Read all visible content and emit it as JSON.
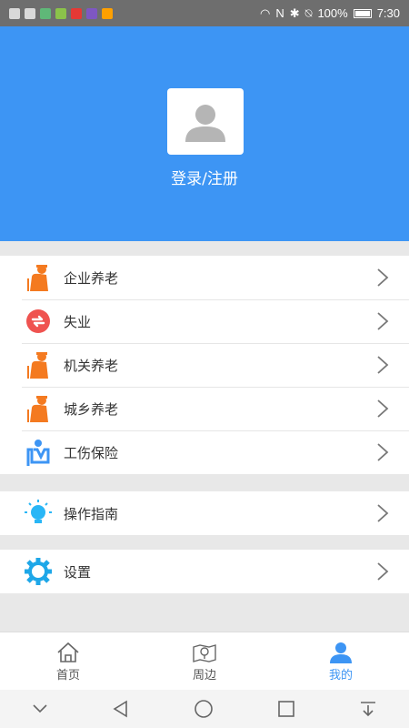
{
  "status_bar": {
    "battery": "100%",
    "time": "7:30"
  },
  "header": {
    "login_text": "登录/注册"
  },
  "menu_group_1": [
    {
      "label": "企业养老",
      "icon": "elderly-icon",
      "color": "#f47a20"
    },
    {
      "label": "失业",
      "icon": "refresh-icon",
      "color": "#ef5350"
    },
    {
      "label": "机关养老",
      "icon": "elderly-icon",
      "color": "#f47a20"
    },
    {
      "label": "城乡养老",
      "icon": "elderly-icon",
      "color": "#f47a20"
    },
    {
      "label": "工伤保险",
      "icon": "injury-icon",
      "color": "#3d95f4"
    }
  ],
  "menu_group_2": [
    {
      "label": "操作指南",
      "icon": "lightbulb-icon",
      "color": "#29b6f6"
    }
  ],
  "menu_group_3": [
    {
      "label": "设置",
      "icon": "gear-icon",
      "color": "#1ea7e8"
    }
  ],
  "tabs": [
    {
      "label": "首页",
      "icon": "home-icon"
    },
    {
      "label": "周边",
      "icon": "map-pin-icon"
    },
    {
      "label": "我的",
      "icon": "user-icon",
      "active": true
    }
  ],
  "colors": {
    "accent": "#3d95f4",
    "background": "#e8e8e8"
  }
}
